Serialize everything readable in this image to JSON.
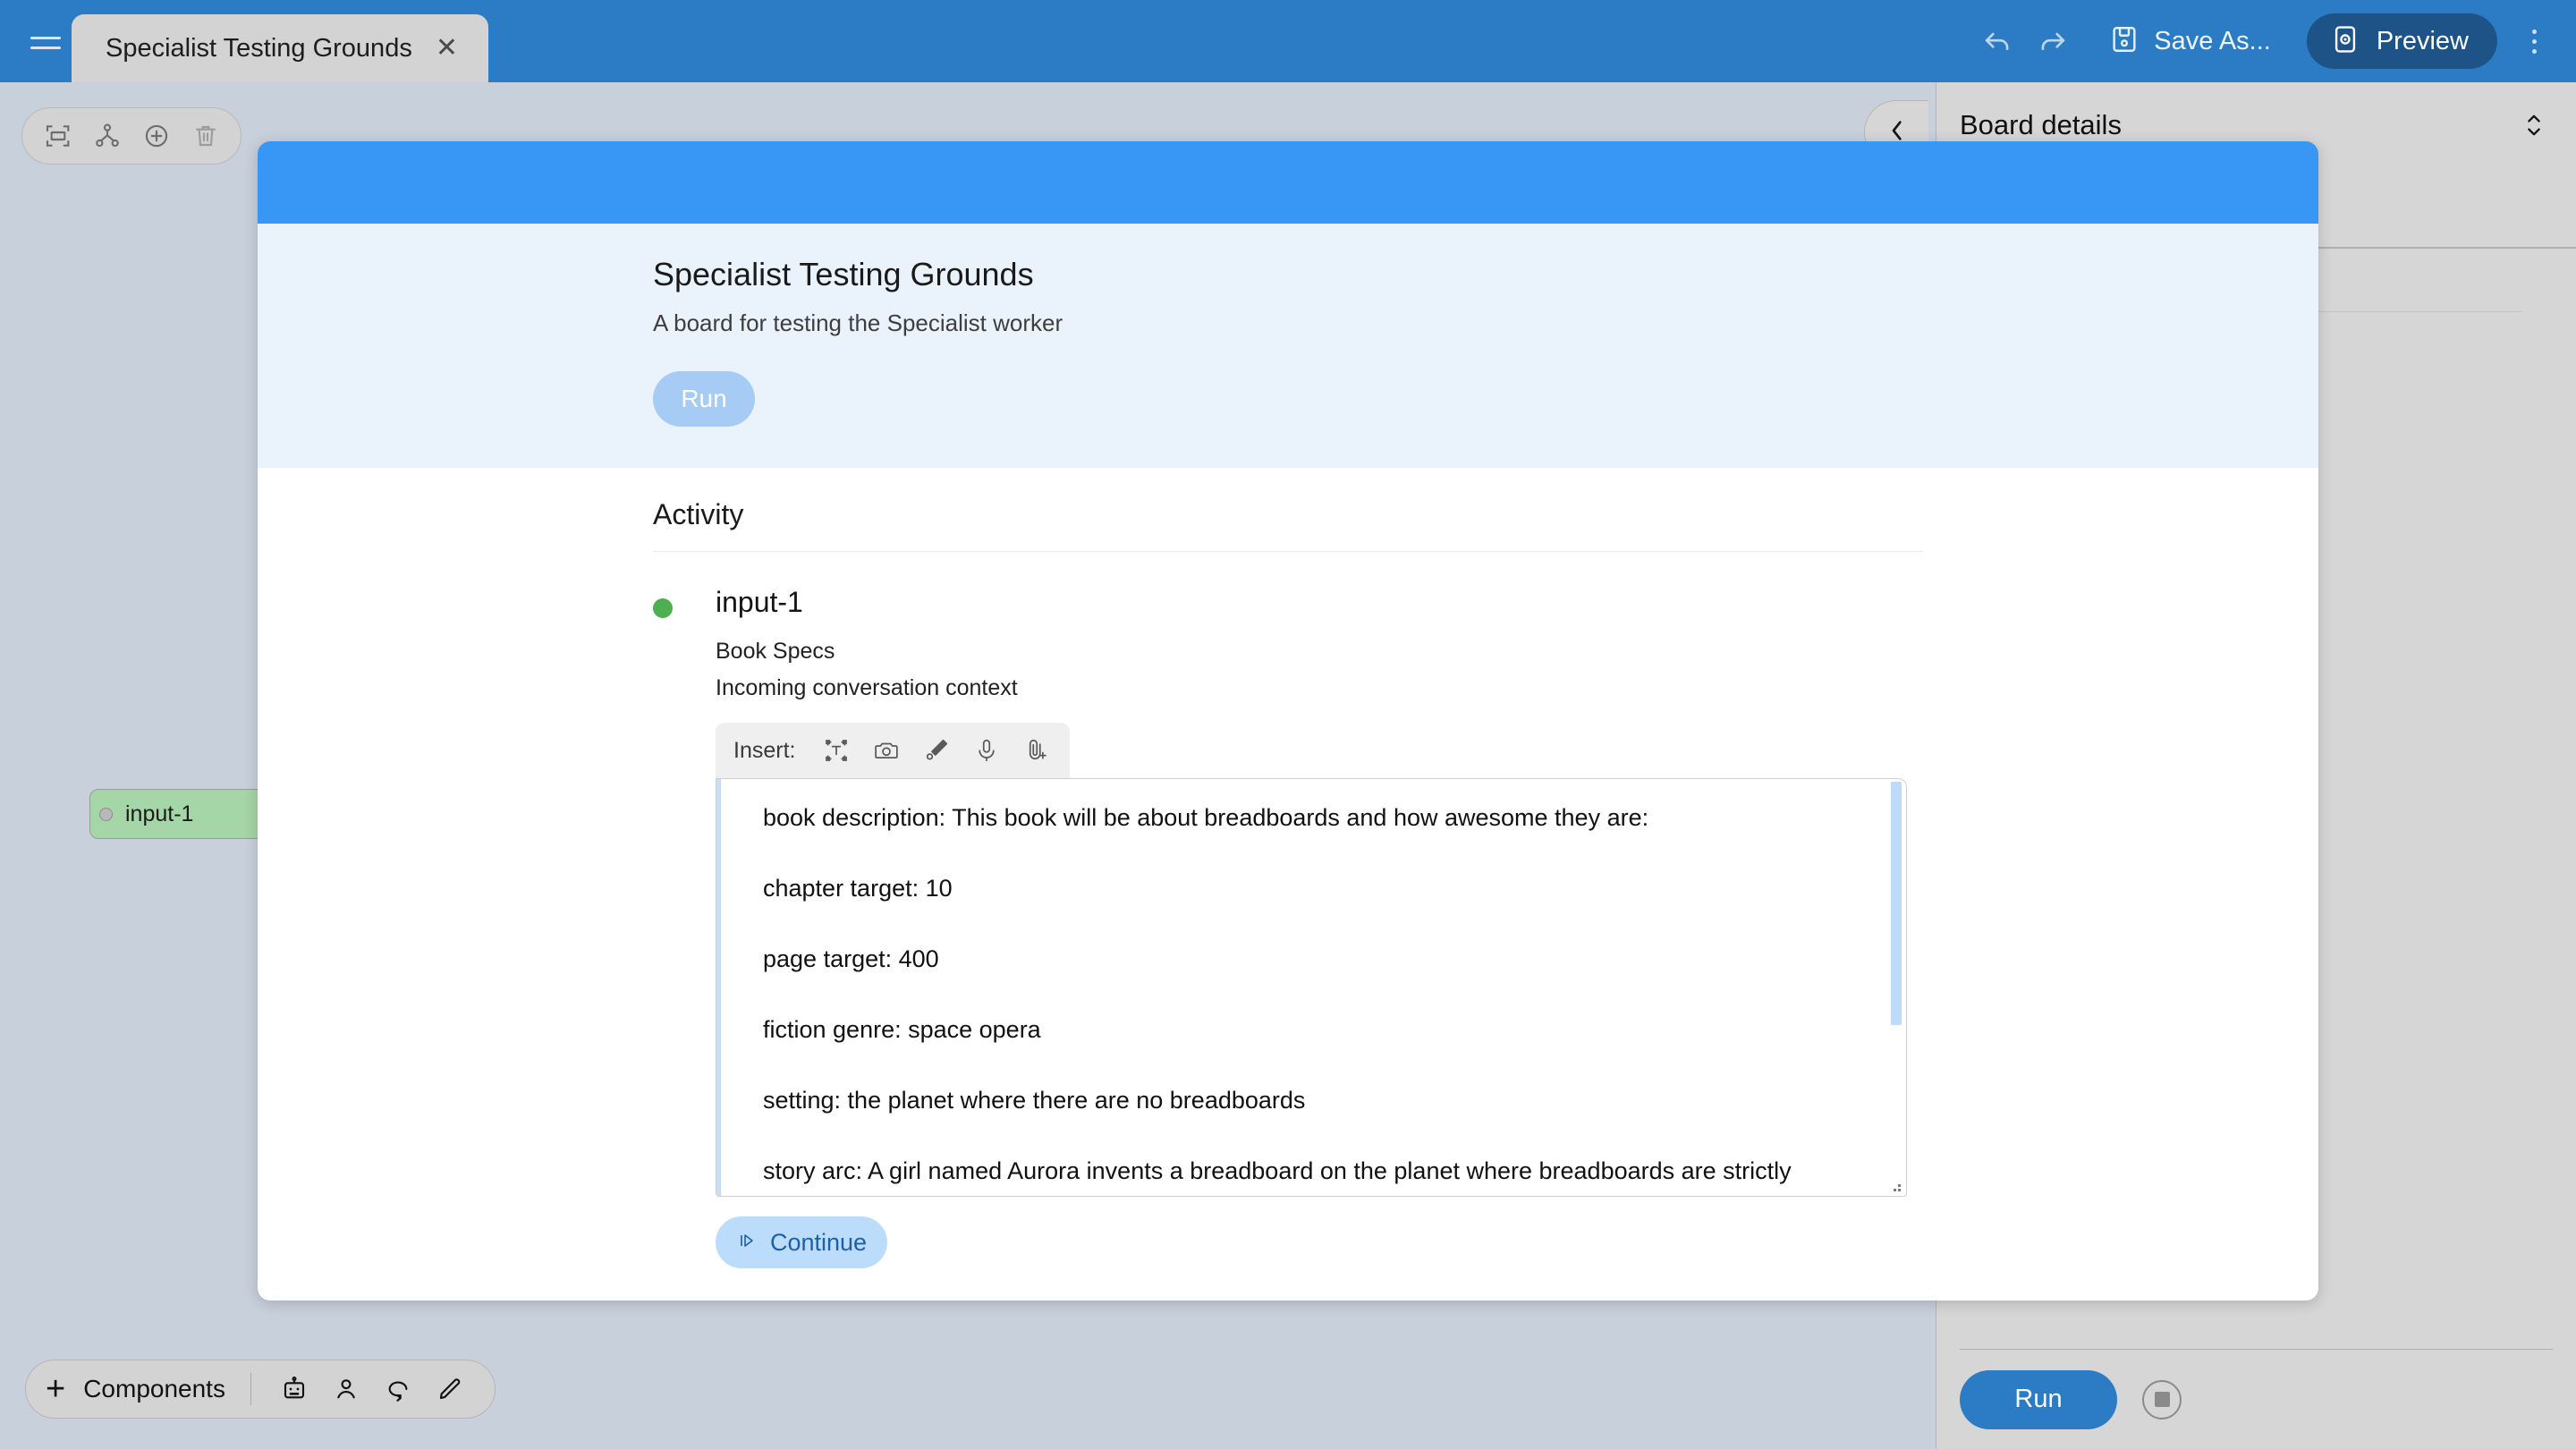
{
  "topbar": {
    "menu_icon": "hamburger-icon",
    "tab": {
      "label": "Specialist Testing Grounds",
      "close_icon": "close-icon"
    },
    "undo_icon": "undo-icon",
    "redo_icon": "redo-icon",
    "save_icon": "save-disk-icon",
    "save_label": "Save As...",
    "preview_icon": "preview-eye-icon",
    "preview_label": "Preview",
    "overflow_icon": "kebab-menu-icon",
    "bg_color": "#2b7cc4",
    "preview_bg": "#1d5386"
  },
  "canvas": {
    "toolbar": [
      {
        "name": "fit-to-screen-icon"
      },
      {
        "name": "hierarchy-graph-icon"
      },
      {
        "name": "add-circle-icon"
      },
      {
        "name": "trash-icon"
      }
    ],
    "nodes": [
      {
        "label": "input-1",
        "color": "#a5d6a7"
      }
    ],
    "bg_color": "#c8d0dc"
  },
  "components_bar": {
    "plus": "+",
    "label": "Components",
    "icons": [
      {
        "name": "robot-icon"
      },
      {
        "name": "person-icon"
      },
      {
        "name": "loop-comment-icon"
      },
      {
        "name": "pencil-icon"
      }
    ]
  },
  "right_panel": {
    "title": "Board details",
    "expand_icon": "chevron-up-down-icon",
    "run_label": "Run",
    "stop_icon": "stop-square-icon",
    "bg_color": "#d6d6d6",
    "run_color": "#2b7cc4"
  },
  "collapse_tab": {
    "icon": "chevron-left-icon"
  },
  "modal": {
    "banner_color": "#3897f5",
    "head_bg": "#eaf3fc",
    "title": "Specialist Testing Grounds",
    "subtitle": "A board for testing the Specialist worker",
    "run_label": "Run",
    "run_color": "#a6cbf5",
    "activity_heading": "Activity",
    "activity": {
      "status_color": "#4caf50",
      "name": "input-1",
      "meta_title": "Book Specs",
      "meta_desc": "Incoming conversation context",
      "insert": {
        "label": "Insert:",
        "icons": [
          {
            "name": "text-box-icon"
          },
          {
            "name": "camera-icon"
          },
          {
            "name": "draw-pen-icon"
          },
          {
            "name": "microphone-icon"
          },
          {
            "name": "attachment-plus-icon"
          }
        ]
      },
      "text_lines": [
        "book description: This book will be about breadboards and how awesome they are:",
        "chapter target: 10",
        "page target: 400",
        "fiction genre: space opera",
        "setting: the planet where there are no breadboards",
        "story arc: A girl named Aurora invents a breadboard on the planet where breadboards are strictly"
      ],
      "continue_icon": "play-step-icon",
      "continue_label": "Continue"
    }
  }
}
